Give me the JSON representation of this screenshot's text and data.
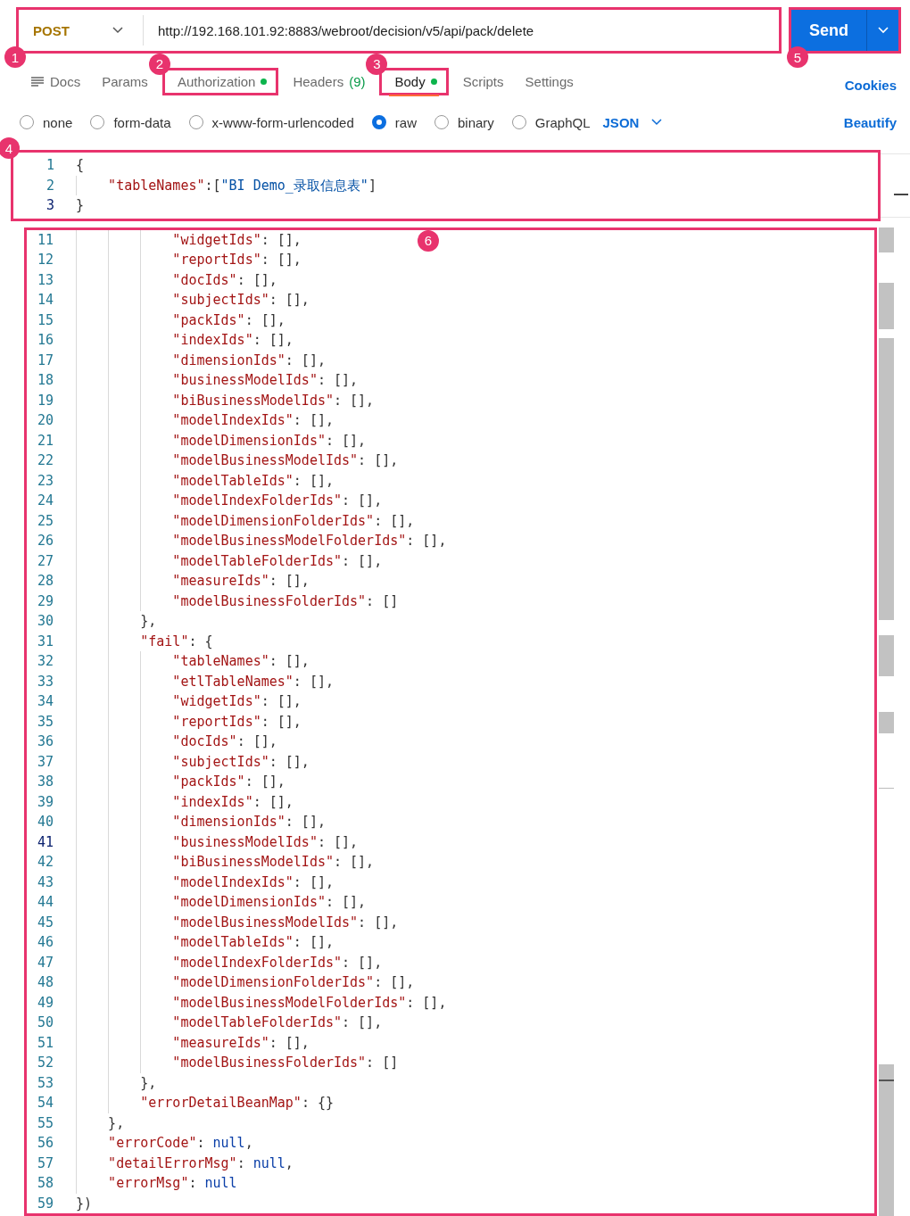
{
  "request": {
    "method": "POST",
    "url": "http://192.168.101.92:8883/webroot/decision/v5/api/pack/delete",
    "callout": "1"
  },
  "send": {
    "label": "Send",
    "callout": "5"
  },
  "tabs": [
    {
      "label": "Docs",
      "kind": "doc",
      "dot": false,
      "selected": false
    },
    {
      "label": "Params",
      "kind": "plain",
      "dot": false,
      "selected": false
    },
    {
      "label": "Authorization",
      "kind": "plain",
      "dot": true,
      "selected": false,
      "callout": "2"
    },
    {
      "label": "Headers",
      "kind": "count",
      "count": "(9)",
      "dot": false,
      "selected": false
    },
    {
      "label": "Body",
      "kind": "plain",
      "dot": true,
      "selected": true,
      "callout": "3"
    },
    {
      "label": "Scripts",
      "kind": "plain",
      "dot": false,
      "selected": false
    },
    {
      "label": "Settings",
      "kind": "plain",
      "dot": false,
      "selected": false
    }
  ],
  "cookies_link": "Cookies",
  "body_modes": [
    {
      "label": "none",
      "selected": false
    },
    {
      "label": "form-data",
      "selected": false
    },
    {
      "label": "x-www-form-urlencoded",
      "selected": false
    },
    {
      "label": "raw",
      "selected": true
    },
    {
      "label": "binary",
      "selected": false
    },
    {
      "label": "GraphQL",
      "selected": false
    }
  ],
  "format": "JSON",
  "beautify_link": "Beautify",
  "request_body": {
    "callout": "4",
    "lines": [
      {
        "n": "1",
        "current": false,
        "tokens": [
          {
            "kind": "punct",
            "text": "{"
          }
        ]
      },
      {
        "n": "2",
        "current": false,
        "tokens": [
          {
            "kind": "key",
            "text": "    \"tableNames\""
          },
          {
            "kind": "punct",
            "text": ":["
          },
          {
            "kind": "string",
            "text": "\"BI Demo_录取信息表\""
          },
          {
            "kind": "punct",
            "text": "]"
          }
        ]
      },
      {
        "n": "3",
        "current": true,
        "tokens": [
          {
            "kind": "punct",
            "text": "}"
          }
        ]
      }
    ]
  },
  "response": {
    "callout": "6",
    "lines": [
      {
        "n": "11",
        "current": false,
        "tokens": [
          {
            "kind": "key",
            "text": "            \"widgetIds\""
          },
          {
            "kind": "punct",
            "text": ": [],"
          }
        ]
      },
      {
        "n": "12",
        "current": false,
        "tokens": [
          {
            "kind": "key",
            "text": "            \"reportIds\""
          },
          {
            "kind": "punct",
            "text": ": [],"
          }
        ]
      },
      {
        "n": "13",
        "current": false,
        "tokens": [
          {
            "kind": "key",
            "text": "            \"docIds\""
          },
          {
            "kind": "punct",
            "text": ": [],"
          }
        ]
      },
      {
        "n": "14",
        "current": false,
        "tokens": [
          {
            "kind": "key",
            "text": "            \"subjectIds\""
          },
          {
            "kind": "punct",
            "text": ": [],"
          }
        ]
      },
      {
        "n": "15",
        "current": false,
        "tokens": [
          {
            "kind": "key",
            "text": "            \"packIds\""
          },
          {
            "kind": "punct",
            "text": ": [],"
          }
        ]
      },
      {
        "n": "16",
        "current": false,
        "tokens": [
          {
            "kind": "key",
            "text": "            \"indexIds\""
          },
          {
            "kind": "punct",
            "text": ": [],"
          }
        ]
      },
      {
        "n": "17",
        "current": false,
        "tokens": [
          {
            "kind": "key",
            "text": "            \"dimensionIds\""
          },
          {
            "kind": "punct",
            "text": ": [],"
          }
        ]
      },
      {
        "n": "18",
        "current": false,
        "tokens": [
          {
            "kind": "key",
            "text": "            \"businessModelIds\""
          },
          {
            "kind": "punct",
            "text": ": [],"
          }
        ]
      },
      {
        "n": "19",
        "current": false,
        "tokens": [
          {
            "kind": "key",
            "text": "            \"biBusinessModelIds\""
          },
          {
            "kind": "punct",
            "text": ": [],"
          }
        ]
      },
      {
        "n": "20",
        "current": false,
        "tokens": [
          {
            "kind": "key",
            "text": "            \"modelIndexIds\""
          },
          {
            "kind": "punct",
            "text": ": [],"
          }
        ]
      },
      {
        "n": "21",
        "current": false,
        "tokens": [
          {
            "kind": "key",
            "text": "            \"modelDimensionIds\""
          },
          {
            "kind": "punct",
            "text": ": [],"
          }
        ]
      },
      {
        "n": "22",
        "current": false,
        "tokens": [
          {
            "kind": "key",
            "text": "            \"modelBusinessModelIds\""
          },
          {
            "kind": "punct",
            "text": ": [],"
          }
        ]
      },
      {
        "n": "23",
        "current": false,
        "tokens": [
          {
            "kind": "key",
            "text": "            \"modelTableIds\""
          },
          {
            "kind": "punct",
            "text": ": [],"
          }
        ]
      },
      {
        "n": "24",
        "current": false,
        "tokens": [
          {
            "kind": "key",
            "text": "            \"modelIndexFolderIds\""
          },
          {
            "kind": "punct",
            "text": ": [],"
          }
        ]
      },
      {
        "n": "25",
        "current": false,
        "tokens": [
          {
            "kind": "key",
            "text": "            \"modelDimensionFolderIds\""
          },
          {
            "kind": "punct",
            "text": ": [],"
          }
        ]
      },
      {
        "n": "26",
        "current": false,
        "tokens": [
          {
            "kind": "key",
            "text": "            \"modelBusinessModelFolderIds\""
          },
          {
            "kind": "punct",
            "text": ": [],"
          }
        ]
      },
      {
        "n": "27",
        "current": false,
        "tokens": [
          {
            "kind": "key",
            "text": "            \"modelTableFolderIds\""
          },
          {
            "kind": "punct",
            "text": ": [],"
          }
        ]
      },
      {
        "n": "28",
        "current": false,
        "tokens": [
          {
            "kind": "key",
            "text": "            \"measureIds\""
          },
          {
            "kind": "punct",
            "text": ": [],"
          }
        ]
      },
      {
        "n": "29",
        "current": false,
        "tokens": [
          {
            "kind": "key",
            "text": "            \"modelBusinessFolderIds\""
          },
          {
            "kind": "punct",
            "text": ": []"
          }
        ]
      },
      {
        "n": "30",
        "current": false,
        "tokens": [
          {
            "kind": "punct",
            "text": "        },"
          }
        ]
      },
      {
        "n": "31",
        "current": false,
        "tokens": [
          {
            "kind": "key",
            "text": "        \"fail\""
          },
          {
            "kind": "punct",
            "text": ": {"
          }
        ]
      },
      {
        "n": "32",
        "current": false,
        "tokens": [
          {
            "kind": "key",
            "text": "            \"tableNames\""
          },
          {
            "kind": "punct",
            "text": ": [],"
          }
        ]
      },
      {
        "n": "33",
        "current": false,
        "tokens": [
          {
            "kind": "key",
            "text": "            \"etlTableNames\""
          },
          {
            "kind": "punct",
            "text": ": [],"
          }
        ]
      },
      {
        "n": "34",
        "current": false,
        "tokens": [
          {
            "kind": "key",
            "text": "            \"widgetIds\""
          },
          {
            "kind": "punct",
            "text": ": [],"
          }
        ]
      },
      {
        "n": "35",
        "current": false,
        "tokens": [
          {
            "kind": "key",
            "text": "            \"reportIds\""
          },
          {
            "kind": "punct",
            "text": ": [],"
          }
        ]
      },
      {
        "n": "36",
        "current": false,
        "tokens": [
          {
            "kind": "key",
            "text": "            \"docIds\""
          },
          {
            "kind": "punct",
            "text": ": [],"
          }
        ]
      },
      {
        "n": "37",
        "current": false,
        "tokens": [
          {
            "kind": "key",
            "text": "            \"subjectIds\""
          },
          {
            "kind": "punct",
            "text": ": [],"
          }
        ]
      },
      {
        "n": "38",
        "current": false,
        "tokens": [
          {
            "kind": "key",
            "text": "            \"packIds\""
          },
          {
            "kind": "punct",
            "text": ": [],"
          }
        ]
      },
      {
        "n": "39",
        "current": false,
        "tokens": [
          {
            "kind": "key",
            "text": "            \"indexIds\""
          },
          {
            "kind": "punct",
            "text": ": [],"
          }
        ]
      },
      {
        "n": "40",
        "current": false,
        "tokens": [
          {
            "kind": "key",
            "text": "            \"dimensionIds\""
          },
          {
            "kind": "punct",
            "text": ": [],"
          }
        ]
      },
      {
        "n": "41",
        "current": true,
        "tokens": [
          {
            "kind": "key",
            "text": "            \"businessModelIds\""
          },
          {
            "kind": "punct",
            "text": ": [],"
          }
        ]
      },
      {
        "n": "42",
        "current": false,
        "tokens": [
          {
            "kind": "key",
            "text": "            \"biBusinessModelIds\""
          },
          {
            "kind": "punct",
            "text": ": [],"
          }
        ]
      },
      {
        "n": "43",
        "current": false,
        "tokens": [
          {
            "kind": "key",
            "text": "            \"modelIndexIds\""
          },
          {
            "kind": "punct",
            "text": ": [],"
          }
        ]
      },
      {
        "n": "44",
        "current": false,
        "tokens": [
          {
            "kind": "key",
            "text": "            \"modelDimensionIds\""
          },
          {
            "kind": "punct",
            "text": ": [],"
          }
        ]
      },
      {
        "n": "45",
        "current": false,
        "tokens": [
          {
            "kind": "key",
            "text": "            \"modelBusinessModelIds\""
          },
          {
            "kind": "punct",
            "text": ": [],"
          }
        ]
      },
      {
        "n": "46",
        "current": false,
        "tokens": [
          {
            "kind": "key",
            "text": "            \"modelTableIds\""
          },
          {
            "kind": "punct",
            "text": ": [],"
          }
        ]
      },
      {
        "n": "47",
        "current": false,
        "tokens": [
          {
            "kind": "key",
            "text": "            \"modelIndexFolderIds\""
          },
          {
            "kind": "punct",
            "text": ": [],"
          }
        ]
      },
      {
        "n": "48",
        "current": false,
        "tokens": [
          {
            "kind": "key",
            "text": "            \"modelDimensionFolderIds\""
          },
          {
            "kind": "punct",
            "text": ": [],"
          }
        ]
      },
      {
        "n": "49",
        "current": false,
        "tokens": [
          {
            "kind": "key",
            "text": "            \"modelBusinessModelFolderIds\""
          },
          {
            "kind": "punct",
            "text": ": [],"
          }
        ]
      },
      {
        "n": "50",
        "current": false,
        "tokens": [
          {
            "kind": "key",
            "text": "            \"modelTableFolderIds\""
          },
          {
            "kind": "punct",
            "text": ": [],"
          }
        ]
      },
      {
        "n": "51",
        "current": false,
        "tokens": [
          {
            "kind": "key",
            "text": "            \"measureIds\""
          },
          {
            "kind": "punct",
            "text": ": [],"
          }
        ]
      },
      {
        "n": "52",
        "current": false,
        "tokens": [
          {
            "kind": "key",
            "text": "            \"modelBusinessFolderIds\""
          },
          {
            "kind": "punct",
            "text": ": []"
          }
        ]
      },
      {
        "n": "53",
        "current": false,
        "tokens": [
          {
            "kind": "punct",
            "text": "        },"
          }
        ]
      },
      {
        "n": "54",
        "current": false,
        "tokens": [
          {
            "kind": "key",
            "text": "        \"errorDetailBeanMap\""
          },
          {
            "kind": "punct",
            "text": ": {}"
          }
        ]
      },
      {
        "n": "55",
        "current": false,
        "tokens": [
          {
            "kind": "punct",
            "text": "    },"
          }
        ]
      },
      {
        "n": "56",
        "current": false,
        "tokens": [
          {
            "kind": "key",
            "text": "    \"errorCode\""
          },
          {
            "kind": "punct",
            "text": ": "
          },
          {
            "kind": "literal",
            "text": "null"
          },
          {
            "kind": "punct",
            "text": ","
          }
        ]
      },
      {
        "n": "57",
        "current": false,
        "tokens": [
          {
            "kind": "key",
            "text": "    \"detailErrorMsg\""
          },
          {
            "kind": "punct",
            "text": ": "
          },
          {
            "kind": "literal",
            "text": "null"
          },
          {
            "kind": "punct",
            "text": ","
          }
        ]
      },
      {
        "n": "58",
        "current": false,
        "tokens": [
          {
            "kind": "key",
            "text": "    \"errorMsg\""
          },
          {
            "kind": "punct",
            "text": ": "
          },
          {
            "kind": "literal",
            "text": "null"
          }
        ]
      },
      {
        "n": "59",
        "current": false,
        "tokens": [
          {
            "kind": "punct",
            "text": "})"
          }
        ]
      }
    ]
  }
}
